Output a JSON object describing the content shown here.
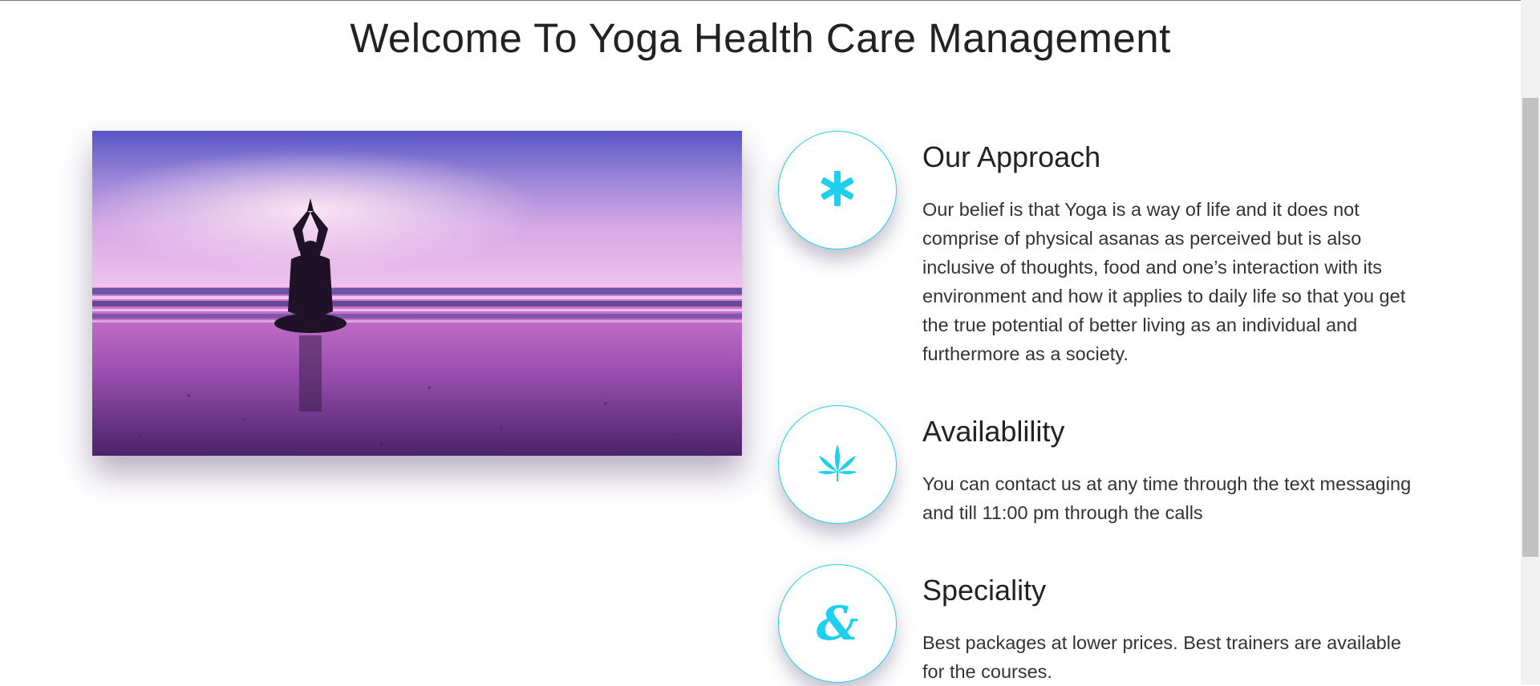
{
  "page": {
    "title": "Welcome To Yoga Health Care Management"
  },
  "hero_image": {
    "alt": "Silhouette of a person meditating on a beach at sunset"
  },
  "features": [
    {
      "title": "Our Approach",
      "text": "Our belief is that Yoga is a way of life and it does not comprise of physical asanas as perceived but is also inclusive of thoughts, food and one’s interaction with its environment and how it applies to daily life so that you get the true potential of better living as an individual and furthermore as a society.",
      "icon": "asterisk-icon"
    },
    {
      "title": "Availablility",
      "text": "You can contact us at any time through the text messaging and till 11:00 pm through the calls",
      "icon": "leaf-icon"
    },
    {
      "title": "Speciality",
      "text": "Best packages at lower prices. Best trainers are available for the courses.",
      "icon": "ampersand-icon"
    }
  ],
  "colors": {
    "accent": "#1ecfee",
    "text": "#2b2b2b"
  }
}
